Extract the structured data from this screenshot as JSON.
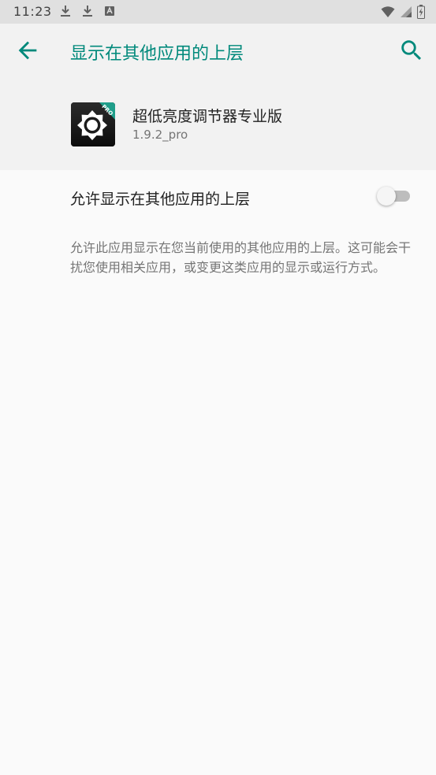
{
  "status_bar": {
    "time": "11:23",
    "left_icons": [
      "download-icon",
      "download-icon",
      "app-notification-icon"
    ],
    "right_icons": [
      "wifi-icon",
      "signal-icon",
      "battery-icon"
    ]
  },
  "app_bar": {
    "title": "显示在其他应用的上层",
    "back_icon": "arrow-back-icon",
    "search_icon": "search-icon"
  },
  "app_info": {
    "name": "超低亮度调节器专业版",
    "version": "1.9.2_pro",
    "icon": "brightness-gear-icon",
    "badge": "PRO"
  },
  "permission": {
    "label": "允许显示在其他应用的上层",
    "enabled": false,
    "description": "允许此应用显示在您当前使用的其他应用的上层。这可能会干扰您使用相关应用，或变更这类应用的显示或运行方式。"
  },
  "colors": {
    "accent": "#00897b",
    "status_bar_bg": "#e0e0e0",
    "header_bg": "#f2f2f2",
    "body_bg": "#fafafa"
  }
}
